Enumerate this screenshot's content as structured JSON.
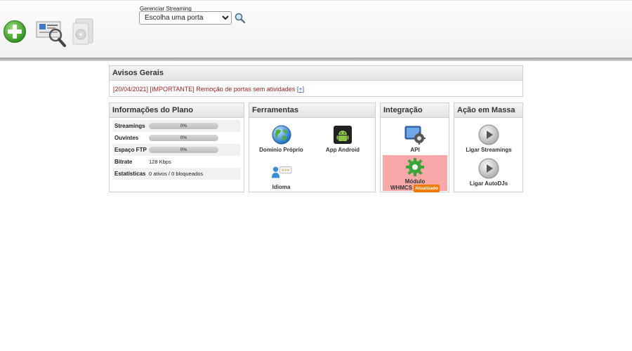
{
  "header": {
    "add_icon": "plus-icon",
    "search_stream_icon": "search-streaming-icon",
    "disk_icon": "disk-icon",
    "stream_label": "Gerenciar Streaming",
    "stream_select_value": "Escolha uma porta",
    "search_button_icon": "magnifier-icon"
  },
  "avisos": {
    "title": "Avisos Gerais",
    "message": "[20/04/2021] [IMPORTANTE] Remoção de portas sem atividades",
    "more": "[+]"
  },
  "plano": {
    "title": "Informações do Plano",
    "rows": [
      {
        "label": "Streamings",
        "progress": 0,
        "progress_text": "0%"
      },
      {
        "label": "Ouvintes",
        "progress": 0,
        "progress_text": "0%"
      },
      {
        "label": "Espaço FTP",
        "progress": 0,
        "progress_text": "0%"
      },
      {
        "label": "Bitrate",
        "value": "128 Kbps"
      },
      {
        "label": "Estatísticas",
        "value": "0 ativos / 0 bloqueados"
      }
    ]
  },
  "ferramentas": {
    "title": "Ferramentas",
    "items": [
      {
        "label": "Domínio Próprio",
        "icon": "globe-icon"
      },
      {
        "label": "App Android",
        "icon": "android-icon"
      },
      {
        "label": "Idioma",
        "icon": "language-icon"
      }
    ]
  },
  "integracao": {
    "title": "Integração",
    "items": [
      {
        "label": "API",
        "icon": "api-gear-icon"
      },
      {
        "label_line1": "Módulo",
        "label_line2": "WHMCS",
        "badge": "Atualizado",
        "icon": "green-gear-icon"
      }
    ]
  },
  "massa": {
    "title": "Ação em Massa",
    "items": [
      {
        "label": "Ligar Streamings",
        "icon": "play-icon"
      },
      {
        "label": "Ligar AutoDJs",
        "icon": "play-icon"
      }
    ]
  },
  "colors": {
    "notice_text": "#a01f1f",
    "whmcs_highlight": "#f8a8a8",
    "badge": "#f07b00"
  }
}
